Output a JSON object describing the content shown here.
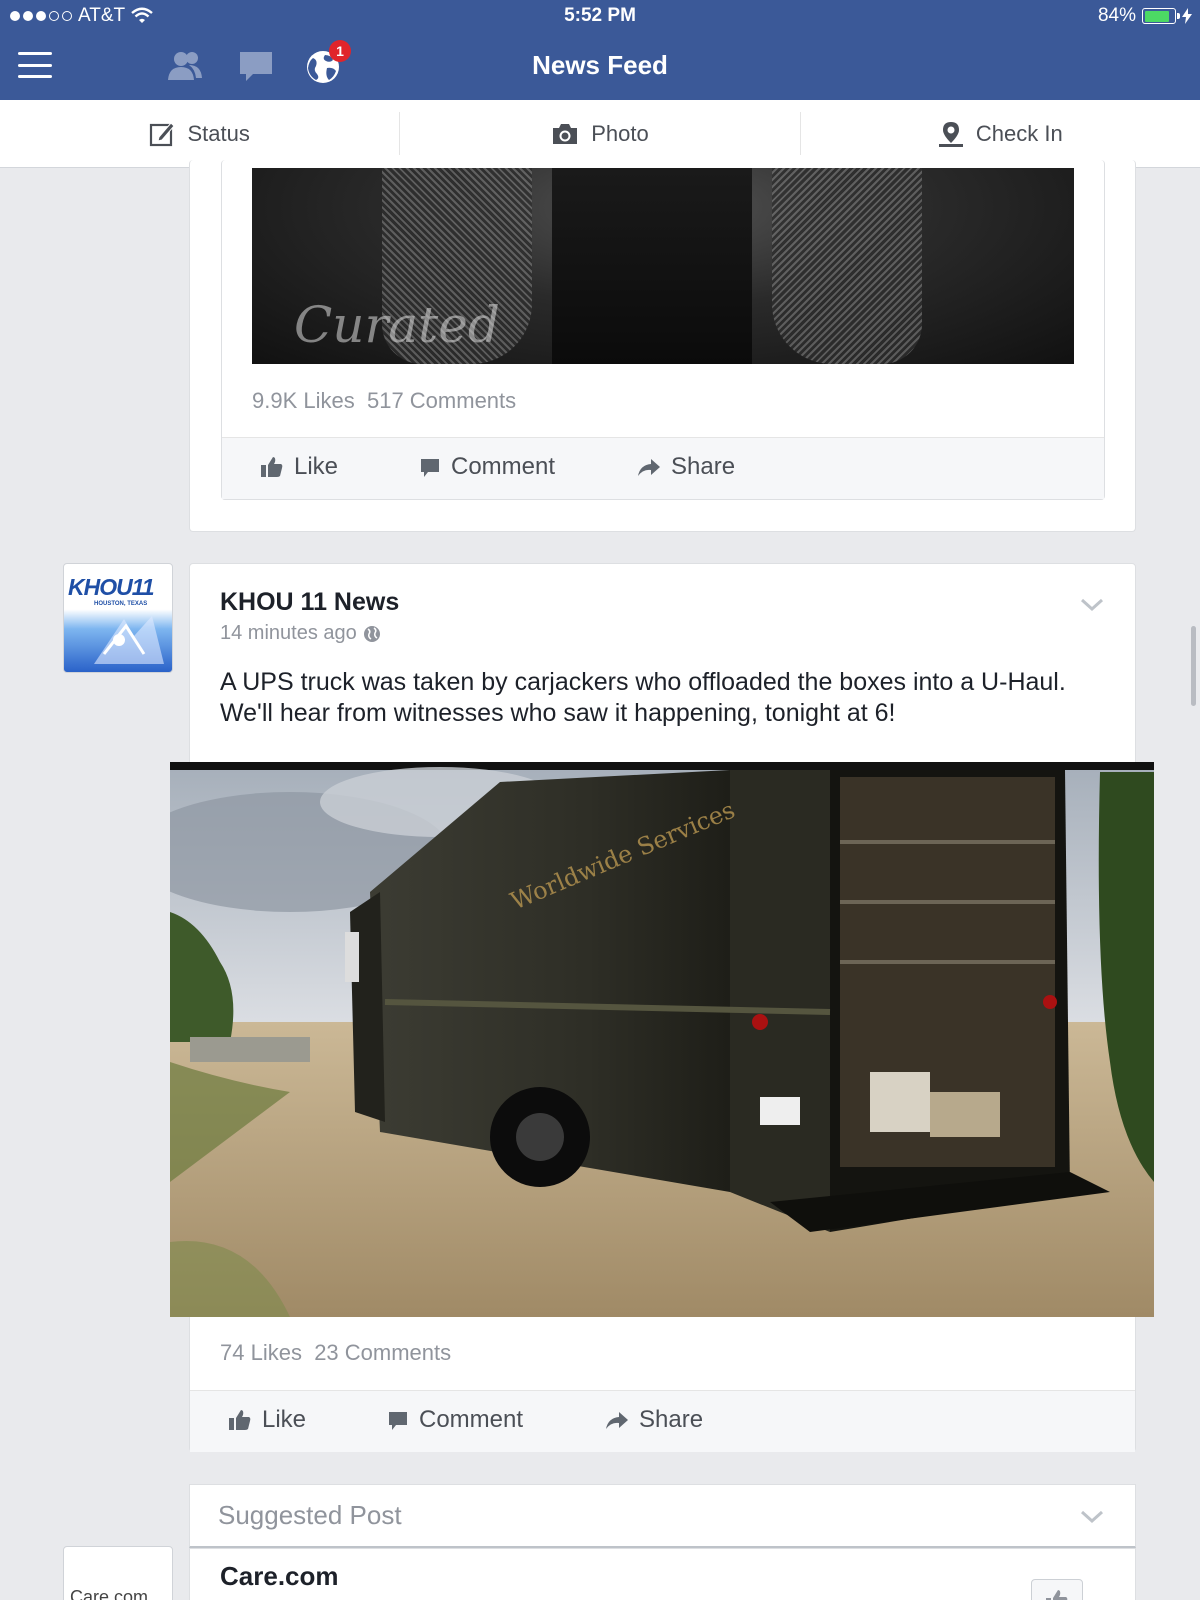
{
  "status_bar": {
    "carrier": "AT&T",
    "time": "5:52 PM",
    "battery": "84%",
    "battery_level": 0.84
  },
  "nav": {
    "title": "News Feed",
    "notification_count": "1"
  },
  "publisher": {
    "status": "Status",
    "photo": "Photo",
    "check_in": "Check In"
  },
  "post1": {
    "photo_signature": "Curated",
    "likes": "9.9K Likes",
    "comments": "517 Comments",
    "actions": {
      "like": "Like",
      "comment": "Comment",
      "share": "Share"
    }
  },
  "post2": {
    "author": "KHOU 11 News",
    "avatar_logo": "KHOU11",
    "avatar_sub": "HOUSTON, TEXAS",
    "time": "14 minutes ago",
    "text": "A UPS truck was taken by carjackers who offloaded the boxes into a U-Haul. We'll hear from witnesses who saw it happening, tonight at 6!",
    "truck_text": "Worldwide Services",
    "likes": "74 Likes",
    "comments": "23 Comments",
    "actions": {
      "like": "Like",
      "comment": "Comment",
      "share": "Share"
    }
  },
  "post3": {
    "header": "Suggested Post",
    "author": "Care.com",
    "avatar_logo": "Care.com"
  },
  "colors": {
    "brand": "#3b5998",
    "feed_bg": "#e9eaed",
    "badge": "#e0242b",
    "battery": "#4cd964"
  }
}
